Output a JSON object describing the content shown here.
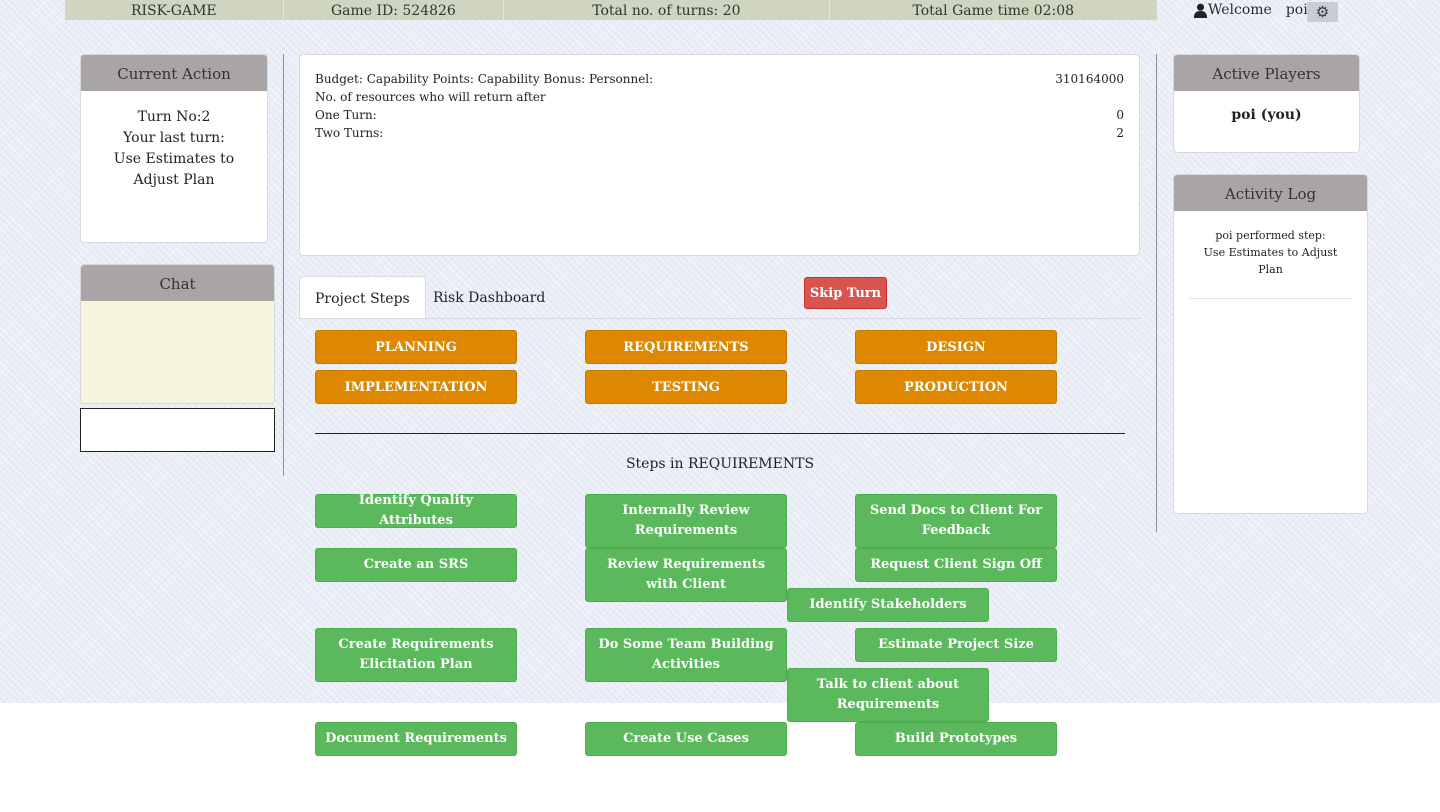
{
  "topbar": {
    "app_name": "RISK-GAME",
    "game_id": "Game ID: 524826",
    "turns": "Total no. of turns: 20",
    "time": "Total Game time 02:08",
    "welcome": "Welcome",
    "user": "poi!"
  },
  "current_action": {
    "title": "Current Action",
    "turn": "Turn No:2",
    "last_turn_label": "Your last turn:",
    "last_turn_value": "Use Estimates to Adjust Plan"
  },
  "chat": {
    "title": "Chat",
    "input_value": ""
  },
  "info": {
    "budget_label": "Budget: Capability Points: Capability Bonus: Personnel:",
    "budget_value": "310164000",
    "resources_label": "No. of resources who will return after",
    "one_turn_label": "One Turn:",
    "one_turn_value": "0",
    "two_turns_label": "Two Turns:",
    "two_turns_value": "2"
  },
  "tabs": {
    "project_steps": "Project Steps",
    "risk_dashboard": "Risk Dashboard"
  },
  "skip_turn": "Skip Turn",
  "phases": [
    "PLANNING",
    "REQUIREMENTS",
    "DESIGN",
    "IMPLEMENTATION",
    "TESTING",
    "PRODUCTION"
  ],
  "steps_title": "Steps in REQUIREMENTS",
  "steps": [
    "Identify Quality Attributes",
    "Internally Review Requirements",
    "Send Docs to Client For Feedback",
    "Create an SRS",
    "Review Requirements with Client",
    "Request Client Sign Off",
    "Identify Stakeholders",
    "Create Requirements Elicitation Plan",
    "Do Some Team Building Activities",
    "Estimate Project Size",
    "Talk to client about Requirements",
    "Document Requirements",
    "Create Use Cases",
    "Build Prototypes"
  ],
  "active_players": {
    "title": "Active Players",
    "player": "poi (you)"
  },
  "activity_log": {
    "title": "Activity Log",
    "entry": "poi performed step: Use Estimates to Adjust Plan"
  },
  "colors": {
    "phase": "#dd8800",
    "step": "#5cb85c",
    "skip": "#d9534f",
    "panel_head": "#a9a5a6",
    "chat_bg": "#f5f5dc"
  },
  "icons": {
    "user": "user-icon",
    "settings": "gear-icon"
  }
}
